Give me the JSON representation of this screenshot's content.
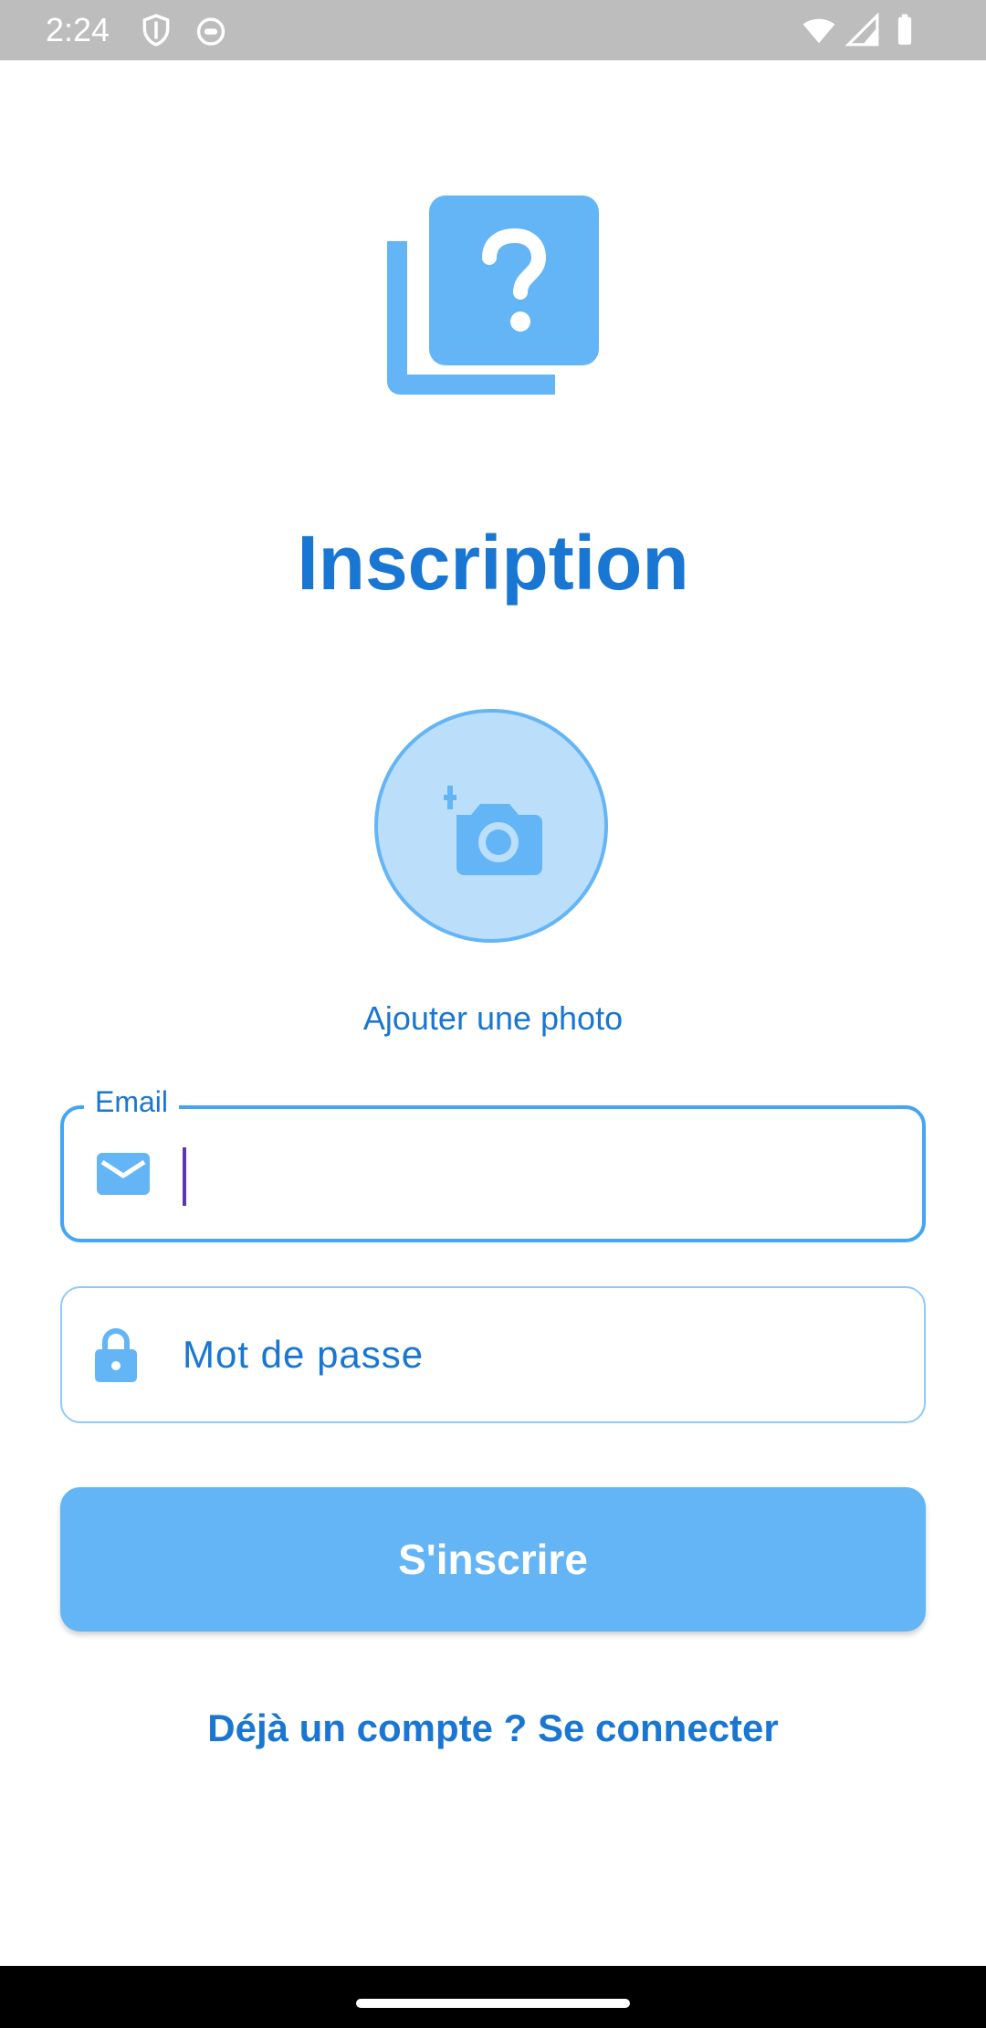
{
  "status_bar": {
    "time": "2:24"
  },
  "header": {
    "title": "Inscription"
  },
  "photo": {
    "label": "Ajouter une photo"
  },
  "email_field": {
    "label": "Email",
    "value": ""
  },
  "password_field": {
    "placeholder": "Mot de passe"
  },
  "actions": {
    "submit_label": "S'inscrire",
    "login_link": "Déjà un compte ? Se connecter"
  },
  "colors": {
    "primary": "#1976d2",
    "accent_light": "#64b5f6",
    "avatar_fill": "#bbdefb"
  },
  "icons": {
    "logo": "help-center-icon",
    "avatar": "add-a-photo-icon",
    "email": "mail-icon",
    "password": "lock-icon"
  }
}
